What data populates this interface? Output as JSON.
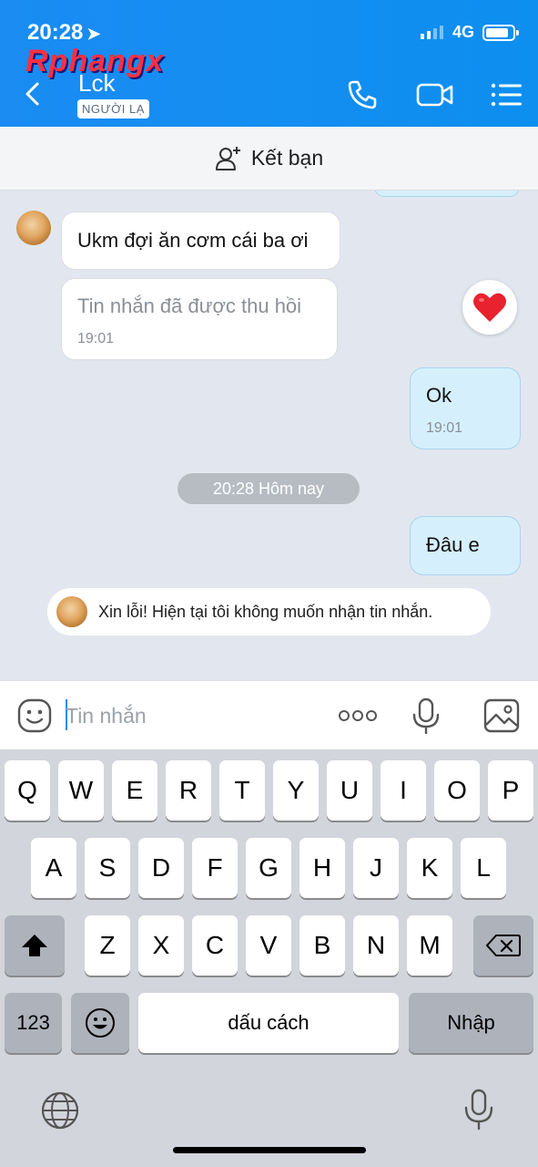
{
  "status_bar": {
    "time": "20:28",
    "location_arrow": "location-arrow-icon",
    "network": "4G"
  },
  "watermark": "Rphangx",
  "header": {
    "contact_name": "Lck",
    "badge": "NGƯỜI LẠ",
    "icons": [
      "back-chevron-icon",
      "phone-icon",
      "video-call-icon",
      "menu-list-icon"
    ]
  },
  "friend_bar": {
    "label": "Kết bạn",
    "icon": "add-friend-icon"
  },
  "messages": [
    {
      "side": "in",
      "text": "Ukm đợi ăn cơm cái ba ơi"
    },
    {
      "side": "in",
      "text": "Tin nhắn đã được thu hồi",
      "time": "19:01",
      "recalled": true
    },
    {
      "side": "out",
      "text": "Ok",
      "time": "19:01"
    },
    {
      "side": "out",
      "text": "Đâu e"
    }
  ],
  "reaction": "heart-icon",
  "date_divider": "20:28 Hôm nay",
  "auto_reply": "Xin lỗi! Hiện tại tôi không muốn nhận tin nhắn.",
  "input": {
    "placeholder": "Tin nhắn",
    "value": ""
  },
  "input_icons": [
    "emoji-icon",
    "more-dots-icon",
    "microphone-icon",
    "image-icon"
  ],
  "keyboard": {
    "row1": [
      "Q",
      "W",
      "E",
      "R",
      "T",
      "Y",
      "U",
      "I",
      "O",
      "P"
    ],
    "row2": [
      "A",
      "S",
      "D",
      "F",
      "G",
      "H",
      "J",
      "K",
      "L"
    ],
    "row3": [
      "Z",
      "X",
      "C",
      "V",
      "B",
      "N",
      "M"
    ],
    "numbers": "123",
    "space": "dấu cách",
    "return": "Nhập"
  },
  "colors": {
    "header": "#1a8cf2",
    "outgoing_bubble": "#d5effd",
    "chat_bg": "#e2e7ef",
    "heart": "#e8222e"
  }
}
